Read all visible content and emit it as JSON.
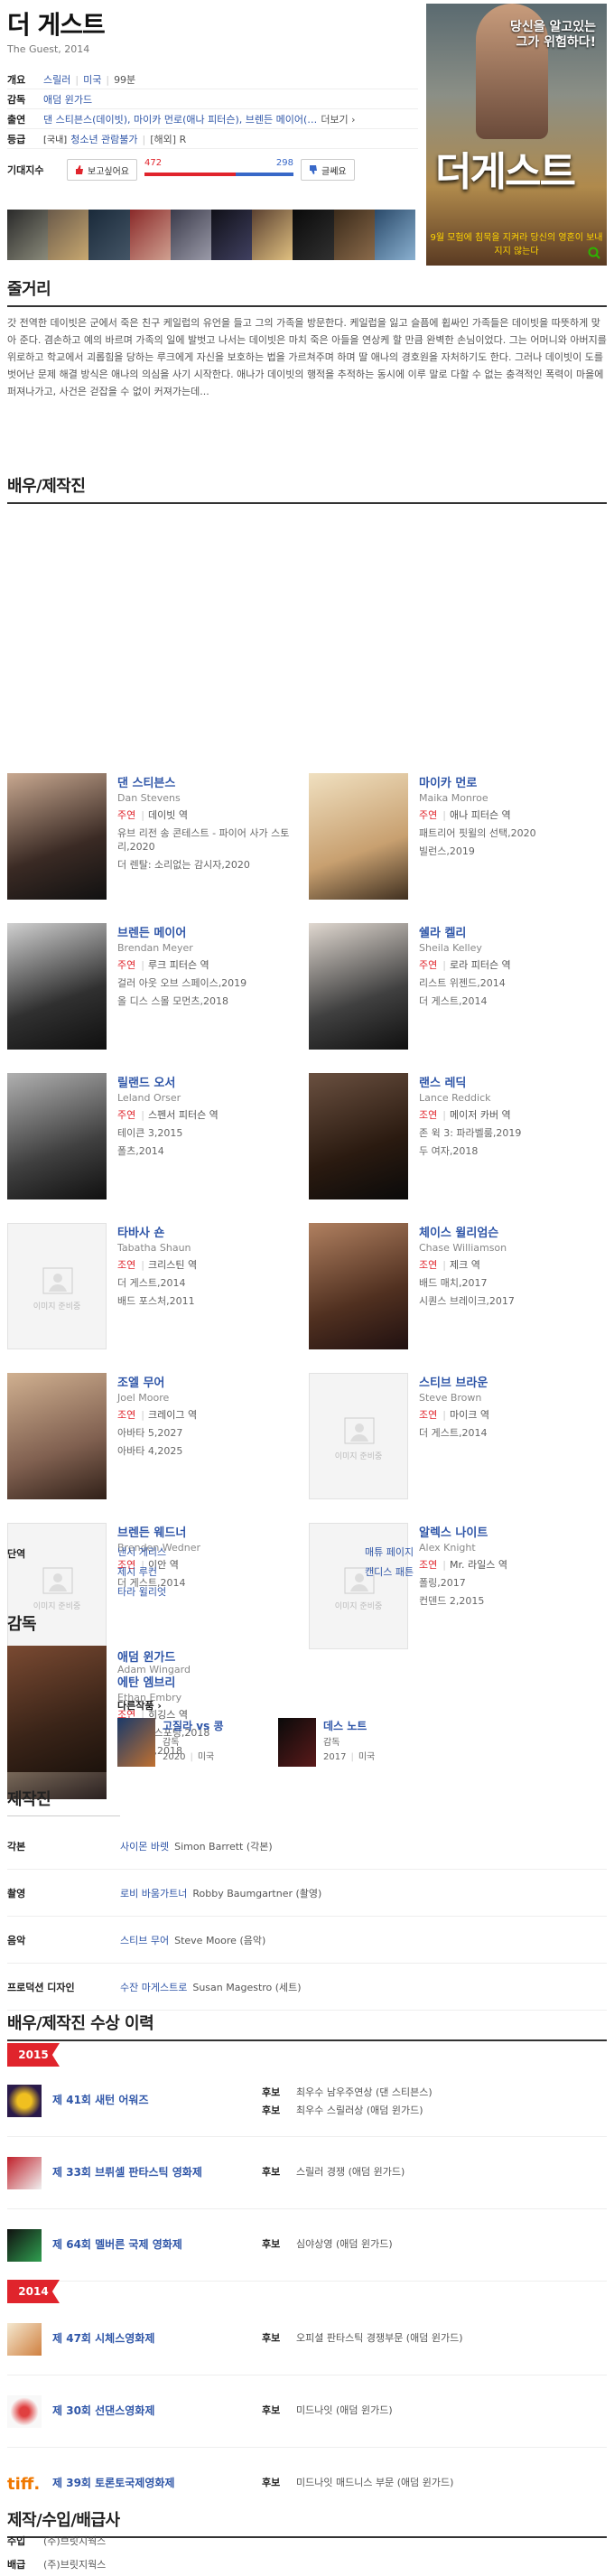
{
  "movie": {
    "title": "더 게스트",
    "subtitle": "The Guest, 2014",
    "info": [
      {
        "label": "개요",
        "parts": [
          "스릴러",
          "미국",
          "99분"
        ]
      },
      {
        "label": "감독",
        "parts": [
          "애덤 윈가드"
        ]
      },
      {
        "label": "출연",
        "parts": [
          "댄 스티븐스(데이빗), 마이카 먼로(애나 피터슨), 브렌든 메이어(…"
        ],
        "more": "더보기"
      },
      {
        "label": "등급",
        "badge": "[국내]",
        "parts": [
          "청소년 관람불가"
        ],
        "badge2": "[해외] R"
      }
    ],
    "want": {
      "label": "기대지수",
      "want_btn": "보고싶어요",
      "yes": "472",
      "no": "298",
      "yes_ratio": 0.613,
      "no_btn": "글쎄요"
    },
    "poster": {
      "tagline": "당신을 알고있는 그가 위험하다!",
      "title": "더게스트",
      "footer": "9월 모험에 침묵을 지켜라 당신의 영혼이 보내지지 않는다"
    }
  },
  "synopsis": {
    "title": "줄거리",
    "text": "갓 전역한 데이빗은 군에서 죽은 친구 케일럽의 유언을 들고 그의 가족을 방문한다. 케일럽을 잃고 슬픔에 휩싸인 가족들은 데이빗을 따뜻하게 맞아 준다. 겸손하고 예의 바르며 가족의 일에 발벗고 나서는 데이빗은 마치 죽은 아들을 연상케 할 만큼 완벽한 손님이었다. 그는 어머니와 아버지를 위로하고 학교에서 괴롭힘을 당하는 루크에게 자신을 보호하는 법을 가르쳐주며 하며 딸 애나의 경호원을 자처하기도 한다. 그러나 데이빗이 도를 벗어난 문제 해결 방식은 애나의 의심을 사기 시작한다. 애나가 데이빗의 행적을 추적하는 동시에 이루 말로 다할 수 없는 충격적인 폭력이 마을에 퍼져나가고, 사건은 걷잡을 수 없이 커져가는데..."
  },
  "cast": {
    "title": "배우/제작진",
    "items": [
      {
        "name": "댄 스티븐스",
        "ename": "Dan Stevens",
        "role_type": "주연",
        "role": "데이빗 역",
        "films": [
          "유브 리전 송 콘테스트 - 파이어 사가 스토리,2020",
          "더 렌탈: 소리없는 감시자,2020"
        ]
      },
      {
        "name": "마이카 먼로",
        "ename": "Maika Monroe",
        "role_type": "주연",
        "role": "애나 피터슨 역",
        "films": [
          "패트리어 핏윌의 선택,2020",
          "빌런스,2019"
        ]
      },
      {
        "name": "브렌든 메이어",
        "ename": "Brendan Meyer",
        "role_type": "주연",
        "role": "루크 피터슨 역",
        "films": [
          "걸러 아웃 오브 스페이스,2019",
          "올 디스 스몰 모먼츠,2018"
        ]
      },
      {
        "name": "쉘라 켈리",
        "ename": "Sheila Kelley",
        "role_type": "주연",
        "role": "로라 피터슨 역",
        "films": [
          "리스트 위젠드,2014",
          "더 게스트,2014"
        ]
      },
      {
        "name": "릴랜드 오서",
        "ename": "Leland Orser",
        "role_type": "주연",
        "role": "스펜서 피터슨 역",
        "films": [
          "테이큰 3,2015",
          "폴츠,2014"
        ]
      },
      {
        "name": "랜스 레딕",
        "ename": "Lance Reddick",
        "role_type": "조연",
        "role": "메이저 카버 역",
        "films": [
          "존 윅 3: 파라벨룸,2019",
          "두 여자,2018"
        ]
      },
      {
        "name": "타바사 숀",
        "ename": "Tabatha Shaun",
        "role_type": "조연",
        "role": "크리스틴 역",
        "films": [
          "더 게스트,2014",
          "배드 포스처,2011"
        ],
        "nophoto": true
      },
      {
        "name": "체이스 윌리엄슨",
        "ename": "Chase Williamson",
        "role_type": "조연",
        "role": "제크 역",
        "films": [
          "배드 매치,2017",
          "시퀀스 브레이크,2017"
        ]
      },
      {
        "name": "조엘 무어",
        "ename": "Joel Moore",
        "role_type": "조연",
        "role": "크레이그 역",
        "films": [
          "아바타 5,2027",
          "아바타 4,2025"
        ]
      },
      {
        "name": "스티브 브라운",
        "ename": "Steve Brown",
        "role_type": "조연",
        "role": "마이크 역",
        "films": [
          "더 게스트,2014"
        ],
        "nophoto": true
      },
      {
        "name": "브렌든 웨드너",
        "ename": "Brenden Wedner",
        "role_type": "조연",
        "role": "이안 역",
        "films": [
          "더 게스트,2014"
        ],
        "nophoto": true
      },
      {
        "name": "알렉스 나이트",
        "ename": "Alex Knight",
        "role_type": "조연",
        "role": "Mr. 라일스 역",
        "films": [
          "폴링,2017",
          "컨덴드 2,2015"
        ],
        "nophoto": true
      },
      {
        "name": "에탄 엠브리",
        "ename": "Ethan Embry",
        "role_type": "조연",
        "role": "히깅스 역",
        "films": [
          "블라인드스포팅,2018",
          "퍼스트맨,2018"
        ]
      }
    ],
    "nophoto_text": "이미지 준비중"
  },
  "cameo": {
    "label": "단역",
    "col1": [
      "낸시 게리스",
      "제시 루컨",
      "타라 윌리엇"
    ],
    "col2": [
      "매튜 페이지",
      "캔디스 패튼"
    ]
  },
  "director": {
    "title": "감독",
    "name": "애덤 윈가드",
    "ename": "Adam Wingard",
    "other_label": "다른작품",
    "films": [
      {
        "title": "고질라 vs 콩",
        "meta": "감독",
        "year": "2020",
        "country": "미국"
      },
      {
        "title": "데스 노트",
        "meta": "감독",
        "year": "2017",
        "country": "미국"
      }
    ]
  },
  "crew": {
    "title": "제작진",
    "rows": [
      {
        "label": "각본",
        "kname": "사이몬 바렛",
        "ename": "Simon Barrett (각본)"
      },
      {
        "label": "촬영",
        "kname": "로비 바움가트너",
        "ename": "Robby Baumgartner (촬영)"
      },
      {
        "label": "음악",
        "kname": "스티브 무어",
        "ename": "Steve Moore (음악)"
      },
      {
        "label": "프로덕션 디자인",
        "kname": "수잔 마게스트로",
        "ename": "Susan Magestro (세트)"
      }
    ]
  },
  "awards": {
    "title": "배우/제작진 수상 이력",
    "years": [
      "2015",
      "2014"
    ],
    "items": [
      {
        "name": "제 41회 새턴 어워즈",
        "entries": [
          {
            "result": "후보",
            "category": "최우수 남우주연상 (댄 스티븐스)"
          },
          {
            "result": "후보",
            "category": "최우수 스릴러상 (애덤 윈가드)"
          }
        ]
      },
      {
        "name": "제 33회 브뤼셀 판타스틱 영화제",
        "entries": [
          {
            "result": "후보",
            "category": "스릴러 경쟁 (애덤 윈가드)"
          }
        ]
      },
      {
        "name": "제 64회 멜버른 국제 영화제",
        "entries": [
          {
            "result": "후보",
            "category": "심야상영 (애덤 윈가드)"
          }
        ]
      },
      {
        "name": "제 47회 시체스영화제",
        "entries": [
          {
            "result": "후보",
            "category": "오피셜 판타스틱 경쟁부문 (애덤 윈가드)"
          }
        ]
      },
      {
        "name": "제 30회 선댄스영화제",
        "entries": [
          {
            "result": "후보",
            "category": "미드나잇 (애덤 윈가드)"
          }
        ]
      },
      {
        "name": "제 39회 토론토국제영화제",
        "entries": [
          {
            "result": "후보",
            "category": "미드나잇 매드니스 부문 (애덤 윈가드)"
          }
        ]
      }
    ]
  },
  "distribution": {
    "title": "제작/수입/배급사",
    "rows": [
      {
        "label": "수입",
        "value": "(주)브릿지웍스"
      },
      {
        "label": "배급",
        "value": "(주)브릿지웍스"
      }
    ]
  }
}
